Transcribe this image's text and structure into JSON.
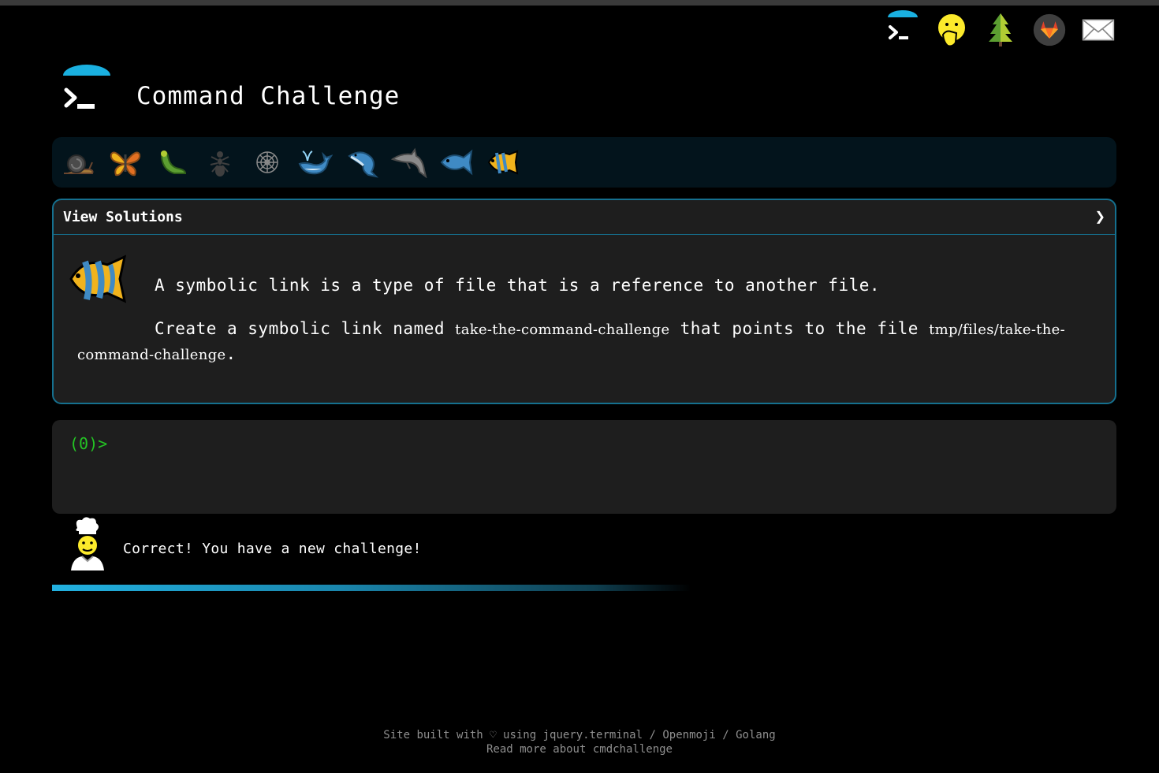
{
  "header": {
    "title": "Command Challenge",
    "nav_icons": [
      "terminal-logo-icon",
      "face-with-hand-over-mouth-icon",
      "evergreen-tree-icon",
      "gitlab-icon",
      "envelope-icon"
    ]
  },
  "levels": [
    "snail-icon",
    "butterfly-icon",
    "bug-icon",
    "ant-icon",
    "spider-web-icon",
    "spouting-whale-icon",
    "whale-icon",
    "dolphin-icon",
    "fish-icon",
    "tropical-fish-icon"
  ],
  "panel": {
    "header_label": "View Solutions",
    "chevron": "❯",
    "description_1": "A symbolic link is a type of file that is a reference to another file.",
    "description_2_a": "Create a symbolic link named",
    "link_name": "take-the-command-challenge",
    "description_2_b": "that points to the file",
    "target_file": "tmp/files/take-the-command-challenge",
    "period": "."
  },
  "terminal": {
    "prompt": "(0)>"
  },
  "feedback": {
    "message": "Correct! You have a new challenge!"
  },
  "footer": {
    "built_with": "Site built with ♡ using",
    "jquery_link": "jquery.terminal",
    "sep1": "/",
    "openmoji_link": "Openmoji",
    "sep2": "/",
    "golang_link": "Golang",
    "read_more": "Read more about cmdchallenge"
  },
  "colors": {
    "accent": "#1ab0e0",
    "border": "#15708f",
    "prompt": "#24c424",
    "panel_bg": "#1e1e1e",
    "strip_bg": "#03141c"
  }
}
